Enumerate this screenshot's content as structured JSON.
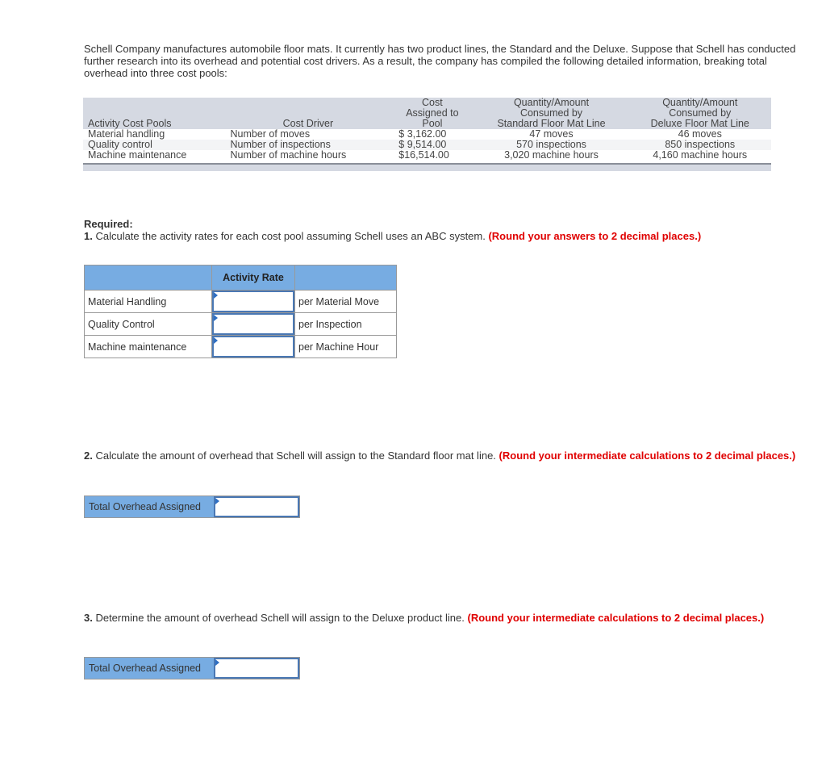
{
  "intro": "Schell Company manufactures automobile floor mats. It currently has two product lines, the Standard and the Deluxe. Suppose that Schell has conducted further research into its overhead and potential cost drivers. As a result, the company has compiled the following detailed information, breaking total overhead into three cost pools:",
  "info_table": {
    "headers": {
      "pool": "Activity Cost Pools",
      "driver": "Cost Driver",
      "cost_line1": "Cost",
      "cost_line2": "Assigned to",
      "cost_line3": "Pool",
      "std_line1": "Quantity/Amount",
      "std_line2": "Consumed by",
      "std_line3": "Standard Floor Mat Line",
      "dlx_line1": "Quantity/Amount",
      "dlx_line2": "Consumed by",
      "dlx_line3": "Deluxe Floor Mat Line"
    },
    "rows": [
      {
        "pool": "Material handling",
        "driver": "Number of moves",
        "cost": "$ 3,162.00",
        "standard": "47 moves",
        "deluxe": "46 moves"
      },
      {
        "pool": "Quality control",
        "driver": "Number of inspections",
        "cost": "$ 9,514.00",
        "standard": "570 inspections",
        "deluxe": "850 inspections"
      },
      {
        "pool": "Machine maintenance",
        "driver": "Number of machine hours",
        "cost": "$16,514.00",
        "standard": "3,020 machine hours",
        "deluxe": "4,160 machine hours"
      }
    ]
  },
  "required": {
    "label": "Required:",
    "q1_num": "1.",
    "q1_text": " Calculate the activity rates for each cost pool assuming Schell uses an ABC system. ",
    "q1_note": "(Round your answers to 2 decimal places.)"
  },
  "rates_table": {
    "header": "Activity Rate",
    "rows": [
      {
        "name": "Material Handling",
        "value": "",
        "unit": "per Material Move"
      },
      {
        "name": "Quality Control",
        "value": "",
        "unit": "per Inspection"
      },
      {
        "name": "Machine maintenance",
        "value": "",
        "unit": "per Machine Hour"
      }
    ]
  },
  "q2": {
    "num": "2.",
    "text": " Calculate the amount of overhead that Schell will assign to the Standard floor mat line. ",
    "note": "(Round your intermediate calculations to 2 decimal places.)",
    "label": "Total Overhead Assigned",
    "value": ""
  },
  "q3": {
    "num": "3.",
    "text": " Determine the amount of overhead Schell will assign to the Deluxe product line. ",
    "note": "(Round your intermediate calculations to 2 decimal places.)",
    "label": "Total Overhead Assigned",
    "value": ""
  }
}
